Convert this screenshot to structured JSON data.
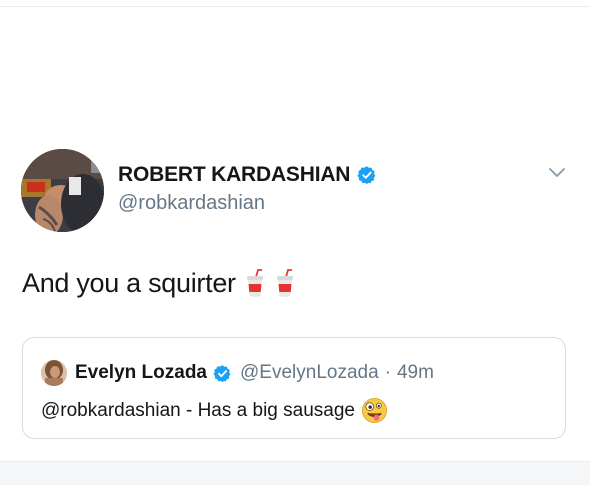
{
  "tweet": {
    "display_name": "ROBERT KARDASHIAN",
    "handle": "@robkardashian",
    "text": "And you a squirter",
    "emojis": [
      "cup-with-straw-icon",
      "cup-with-straw-icon"
    ],
    "verified": true
  },
  "quoted_tweet": {
    "display_name": "Evelyn Lozada",
    "handle": "@EvelynLozada",
    "separator": "·",
    "time": "49m",
    "text": "@robkardashian - Has a big sausage",
    "emoji": "zany-face-icon",
    "verified": true
  },
  "colors": {
    "verified_blue": "#1da1f2",
    "secondary_text": "#657786",
    "primary_text": "#14171a",
    "border": "#d6dde3"
  }
}
